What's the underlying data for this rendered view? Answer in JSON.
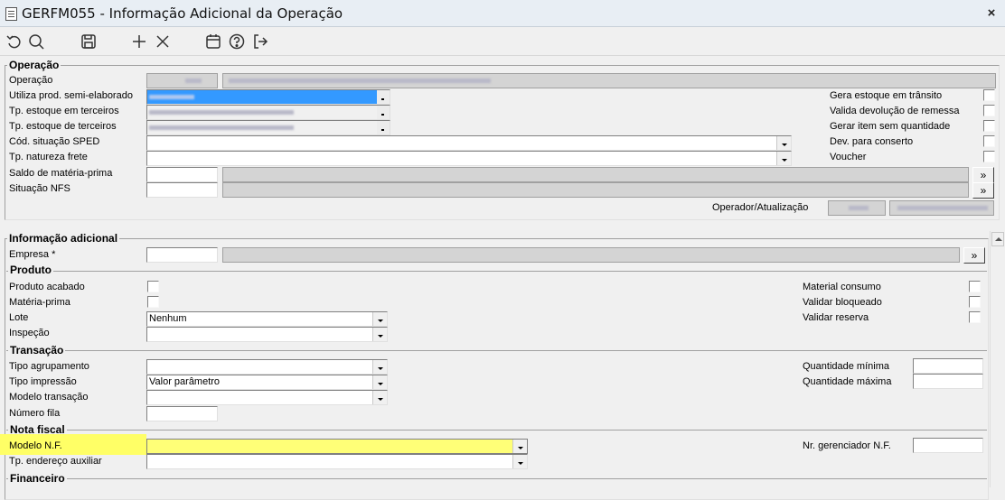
{
  "window": {
    "title": "GERFM055 - Informação Adicional da Operação",
    "close": "×"
  },
  "toolbar": {
    "icons": [
      "undo-icon",
      "search-icon",
      "save-icon",
      "add-icon",
      "delete-icon",
      "calendar-icon",
      "help-icon",
      "exit-icon"
    ]
  },
  "operacao": {
    "group_label": "Operação",
    "operacao_label": "Operação",
    "utiliza_label": "Utiliza prod. semi-elaborado",
    "tp_estoque_em_label": "Tp. estoque em terceiros",
    "tp_estoque_de_label": "Tp. estoque de terceiros",
    "cod_sped_label": "Cód. situação SPED",
    "tp_frete_label": "Tp. natureza frete",
    "saldo_label": "Saldo de matéria-prima",
    "situacao_nfs_label": "Situação NFS",
    "gera_estoque_label": "Gera estoque em trânsito",
    "valida_dev_label": "Valida devolução de remessa",
    "gerar_item_label": "Gerar item sem quantidade",
    "dev_conserto_label": "Dev. para conserto",
    "voucher_label": "Voucher",
    "operador_label": "Operador/Atualização",
    "more": "»"
  },
  "info": {
    "group_label": "Informação adicional",
    "empresa_label": "Empresa *",
    "more": "»",
    "produto": {
      "group_label": "Produto",
      "produto_acabado": "Produto acabado",
      "materia_prima": "Matéria-prima",
      "lote": "Lote",
      "lote_value": "Nenhum",
      "inspecao": "Inspeção",
      "material_consumo": "Material consumo",
      "validar_bloqueado": "Validar bloqueado",
      "validar_reserva": "Validar reserva"
    },
    "transacao": {
      "group_label": "Transação",
      "tipo_agrupamento": "Tipo agrupamento",
      "tipo_impressao": "Tipo impressão",
      "tipo_impressao_value": "Valor parâmetro",
      "modelo_transacao": "Modelo transação",
      "numero_fila": "Número fila",
      "qtd_minima": "Quantidade mínima",
      "qtd_maxima": "Quantidade máxima"
    },
    "nota_fiscal": {
      "group_label": "Nota fiscal",
      "modelo_nf": "Modelo N.F.",
      "tp_endereco": "Tp. endereço auxiliar",
      "nr_gerenciador": "Nr. gerenciador N.F."
    },
    "financeiro": {
      "group_label": "Financeiro"
    }
  },
  "colors": {
    "highlight": "#ffff66",
    "selected": "#3399ff"
  }
}
